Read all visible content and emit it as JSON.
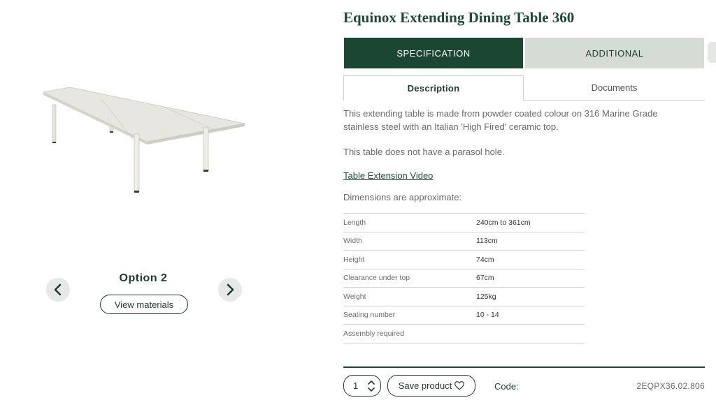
{
  "product": {
    "title": "Equinox Extending Dining Table 360",
    "option_label": "Option 2",
    "view_materials_label": "View materials"
  },
  "tabs": {
    "main": [
      "SPECIFICATION",
      "ADDITIONAL"
    ],
    "sub": [
      "Description",
      "Documents"
    ]
  },
  "description": {
    "paragraph_1": "This extending table is made from powder coated colour on 316 Marine Grade stainless steel with an Italian 'High Fired' ceramic top.",
    "paragraph_2": "This table does not have a parasol hole.",
    "video_link": "Table Extension Video",
    "dimensions_note": "Dimensions are approximate:"
  },
  "specs": [
    {
      "label": "Length",
      "value": "240cm to 361cm"
    },
    {
      "label": "Width",
      "value": "113cm"
    },
    {
      "label": "Height",
      "value": "74cm"
    },
    {
      "label": "Clearance under top",
      "value": "67cm"
    },
    {
      "label": "Weight",
      "value": "125kg"
    },
    {
      "label": "Seating number",
      "value": "10 - 14"
    },
    {
      "label": "Assembly required",
      "value": ""
    }
  ],
  "purchase": {
    "quantity": "1",
    "save_label": "Save product",
    "code_label": "Code:",
    "code_value": "2EQPX36.02.806"
  },
  "icons": {
    "prev": "chevron-left-icon",
    "next": "chevron-right-icon",
    "save": "heart-icon",
    "stepper": "stepper-arrows-icon"
  },
  "colors": {
    "brand_green": "#1b4632",
    "tab_inactive": "#d5dcd6",
    "text_muted": "#6a6a6a"
  }
}
